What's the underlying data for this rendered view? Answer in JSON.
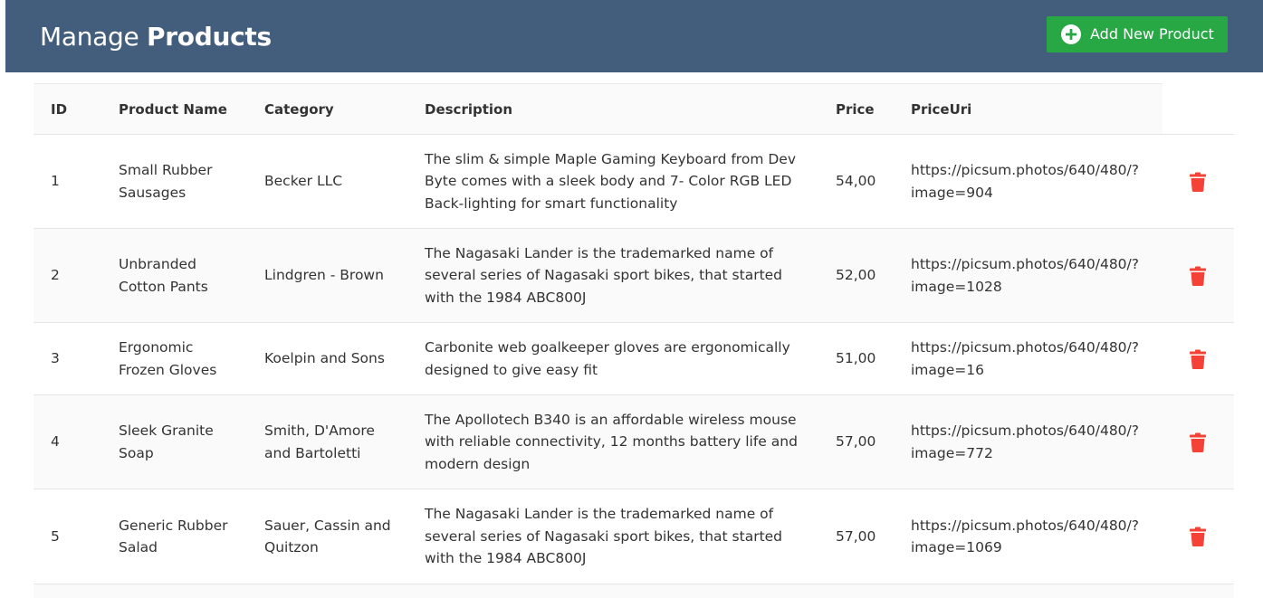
{
  "header": {
    "title_light": "Manage",
    "title_bold": "Products",
    "add_button_label": "Add New Product",
    "add_button_icon": "plus-circle-icon",
    "background_color": "#435d7d",
    "button_color": "#28a745"
  },
  "table": {
    "columns": [
      "ID",
      "Product Name",
      "Category",
      "Description",
      "Price",
      "PriceUri"
    ],
    "delete_icon": "trash-icon",
    "delete_icon_color": "#f44336",
    "rows": [
      {
        "id": "1",
        "name_lines": [
          "Small Rubber",
          "Sausages"
        ],
        "category_lines": [
          "Becker LLC"
        ],
        "description_lines": [
          "The slim & simple Maple Gaming Keyboard from Dev",
          "Byte comes with a sleek body and 7- Color RGB LED",
          "Back-lighting for smart functionality"
        ],
        "price": "54,00",
        "uri_lines": [
          "https://picsum.photos/640/480/?",
          "image=904"
        ]
      },
      {
        "id": "2",
        "name_lines": [
          "Unbranded",
          "Cotton Pants"
        ],
        "category_lines": [
          "Lindgren - Brown"
        ],
        "description_lines": [
          "The Nagasaki Lander is the trademarked name of",
          "several series of Nagasaki sport bikes, that started",
          "with the 1984 ABC800J"
        ],
        "price": "52,00",
        "uri_lines": [
          "https://picsum.photos/640/480/?",
          "image=1028"
        ]
      },
      {
        "id": "3",
        "name_lines": [
          "Ergonomic",
          "Frozen Gloves"
        ],
        "category_lines": [
          "Koelpin and Sons"
        ],
        "description_lines": [
          "Carbonite web goalkeeper gloves are ergonomically",
          "designed to give easy fit"
        ],
        "price": "51,00",
        "uri_lines": [
          "https://picsum.photos/640/480/?",
          "image=16"
        ]
      },
      {
        "id": "4",
        "name_lines": [
          "Sleek Granite",
          "Soap"
        ],
        "category_lines": [
          "Smith, D'Amore",
          "and Bartoletti"
        ],
        "description_lines": [
          "The Apollotech B340 is an affordable wireless mouse",
          "with reliable connectivity, 12 months battery life and",
          "modern design"
        ],
        "price": "57,00",
        "uri_lines": [
          "https://picsum.photos/640/480/?",
          "image=772"
        ]
      },
      {
        "id": "5",
        "name_lines": [
          "Generic Rubber",
          "Salad"
        ],
        "category_lines": [
          "Sauer, Cassin and",
          "Quitzon"
        ],
        "description_lines": [
          "The Nagasaki Lander is the trademarked name of",
          "several series of Nagasaki sport bikes, that started",
          "with the 1984 ABC800J"
        ],
        "price": "57,00",
        "uri_lines": [
          "https://picsum.photos/640/480/?",
          "image=1069"
        ]
      }
    ]
  }
}
